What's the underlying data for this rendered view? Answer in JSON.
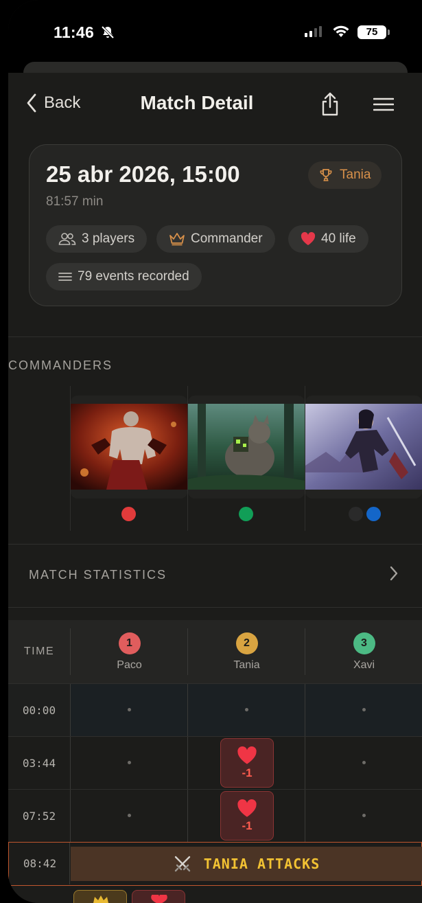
{
  "status": {
    "time": "11:46",
    "battery": "75",
    "icons": [
      "bell-slash-icon",
      "signal-icon",
      "wifi-icon",
      "battery-icon"
    ]
  },
  "nav": {
    "back_label": "Back",
    "title": "Match Detail"
  },
  "match": {
    "date": "25 abr 2026, 15:00",
    "duration": "81:57 min",
    "winner": "Tania",
    "chips": {
      "players": "3 players",
      "format": "Commander",
      "life": "40 life",
      "events": "79 events recorded"
    }
  },
  "sections": {
    "commanders": "COMMANDERS",
    "statistics": "MATCH STATISTICS"
  },
  "commanders": [
    {
      "player": "Paco",
      "colors": [
        "#e13b3b"
      ]
    },
    {
      "player": "Tania",
      "colors": [
        "#119e57"
      ]
    },
    {
      "player": "Xavi",
      "colors": [
        "#2a2a2a",
        "#1466c9"
      ]
    }
  ],
  "timeline": {
    "time_header": "TIME",
    "players": [
      {
        "number": "1",
        "name": "Paco",
        "color": "#e05d5d"
      },
      {
        "number": "2",
        "name": "Tania",
        "color": "#d9a441"
      },
      {
        "number": "3",
        "name": "Xavi",
        "color": "#4cba84"
      }
    ],
    "rows": [
      {
        "time": "00:00"
      },
      {
        "time": "03:44",
        "event": {
          "value": "-1"
        }
      },
      {
        "time": "07:52",
        "event": {
          "value": "-1"
        }
      }
    ],
    "attack": {
      "time": "08:42",
      "text": "TANIA ATTACKS"
    }
  }
}
